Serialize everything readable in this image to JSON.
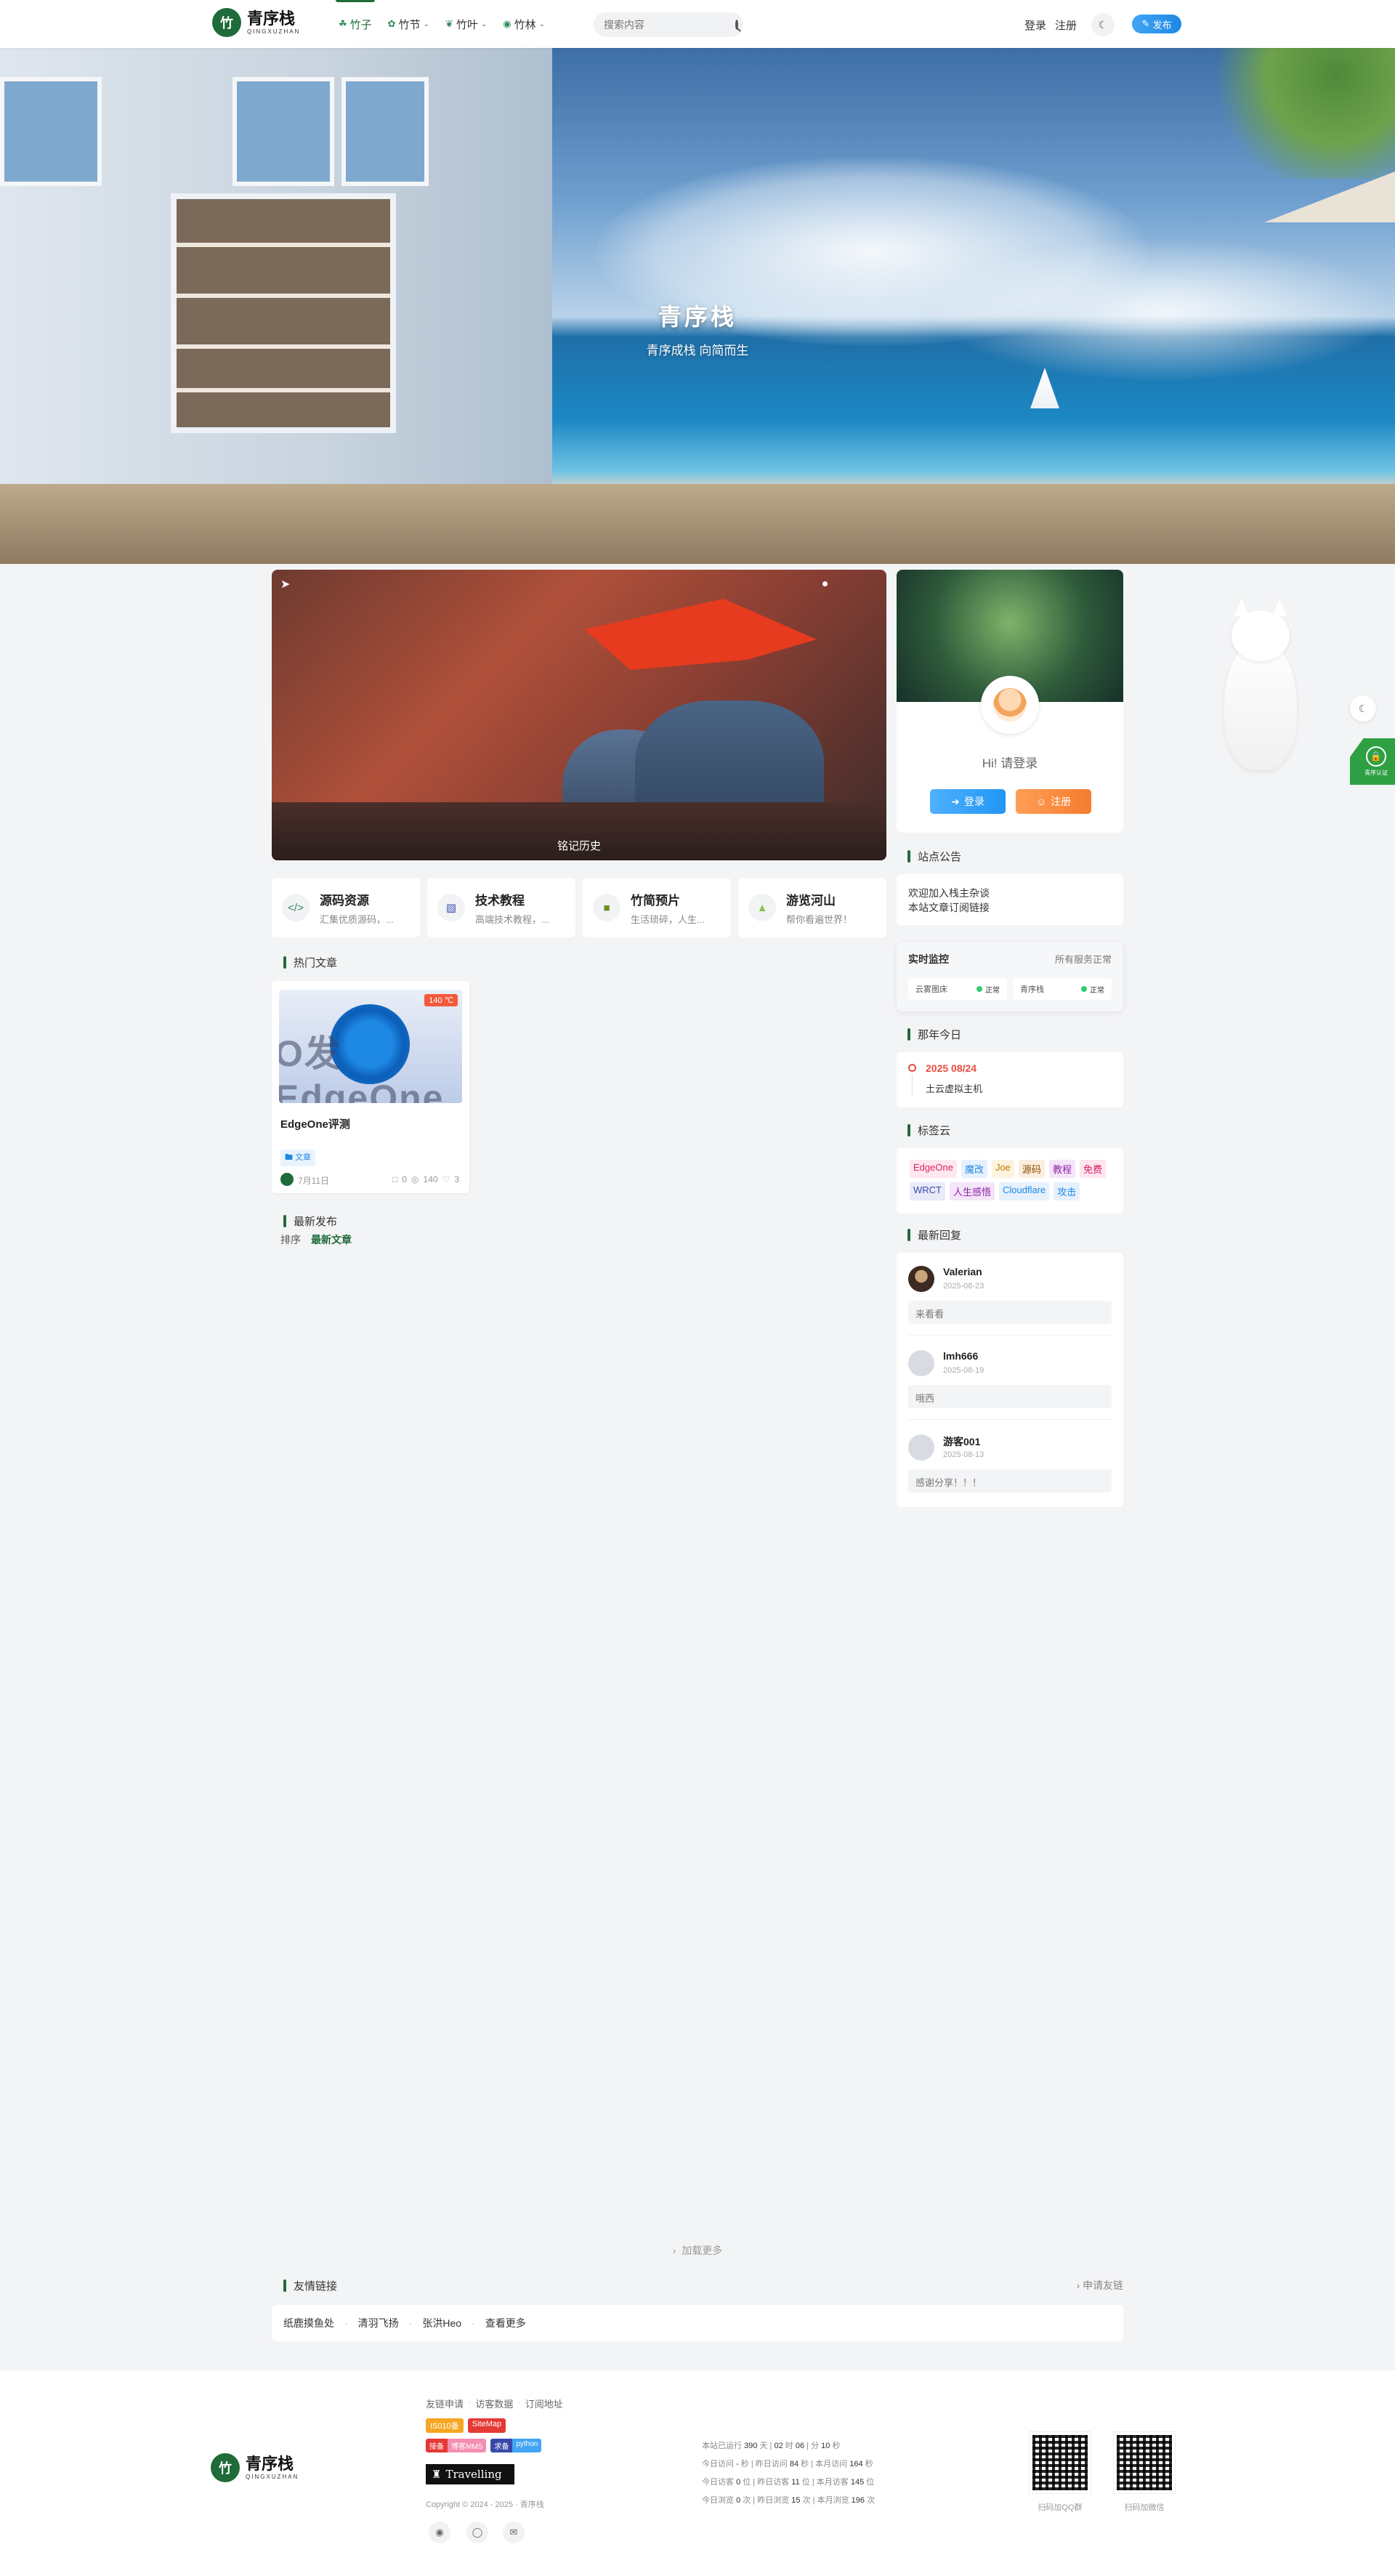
{
  "header": {
    "logo_title": "青序栈",
    "logo_sub": "QINGXUZHAN",
    "nav": [
      {
        "label": "竹子",
        "has_menu": false,
        "active": true
      },
      {
        "label": "竹节",
        "has_menu": true
      },
      {
        "label": "竹叶",
        "has_menu": true
      },
      {
        "label": "竹林",
        "has_menu": true
      }
    ],
    "search_placeholder": "搜索内容",
    "login": "登录",
    "register": "注册",
    "publish": "发布"
  },
  "hero": {
    "title": "青序栈",
    "subtitle": "青序成栈 向简而生"
  },
  "slider": {
    "caption": "铭记历史"
  },
  "categories": [
    {
      "title": "源码资源",
      "desc": "汇集优质源码，...",
      "icon": "code-icon"
    },
    {
      "title": "技术教程",
      "desc": "高端技术教程，...",
      "icon": "image-icon"
    },
    {
      "title": "竹简预片",
      "desc": "生活琐碎，人生...",
      "icon": "picture-icon"
    },
    {
      "title": "游览河山",
      "desc": "帮你看遍世界！",
      "icon": "mountain-icon"
    }
  ],
  "hot": {
    "title": "热门文章",
    "post": {
      "title": "EdgeOne评测",
      "temp": "140 ℃",
      "thumb_text": "O发EdgeOne评测",
      "tag": "文章",
      "date": "7月11日",
      "comments": "0",
      "views": "140",
      "likes": "3"
    }
  },
  "latest": {
    "title": "最新发布",
    "sort_label": "排序",
    "active_tab": "最新文章"
  },
  "load_more": "加载更多",
  "friends": {
    "title": "友情链接",
    "apply": "申请友链",
    "links": [
      "纸鹿摸鱼处",
      "清羽飞扬",
      "张洪Heo",
      "查看更多"
    ]
  },
  "profile": {
    "greeting": "Hi! 请登录",
    "login": "登录",
    "register": "注册"
  },
  "notice": {
    "title": "站点公告",
    "lines": [
      "欢迎加入栈主杂谈",
      "本站文章订阅链接"
    ]
  },
  "monitor": {
    "title": "实时监控",
    "status": "所有服务正常",
    "items": [
      {
        "name": "云雾图床",
        "state": "正常"
      },
      {
        "name": "青序栈",
        "state": "正常"
      }
    ]
  },
  "today": {
    "title": "那年今日",
    "date": "2025 08/24",
    "text": "土云虚拟主机"
  },
  "tags": {
    "title": "标签云",
    "items": [
      {
        "label": "EdgeOne",
        "color": "#e0245e",
        "bg": "#fde8ef"
      },
      {
        "label": "魔改",
        "color": "#1e88e5",
        "bg": "#e6f1fd"
      },
      {
        "label": "Joe",
        "color": "#c07a00",
        "bg": "#fdf3e0"
      },
      {
        "label": "源码",
        "color": "#8a4b00",
        "bg": "#fbeede"
      },
      {
        "label": "教程",
        "color": "#8e24aa",
        "bg": "#f4e5f9"
      },
      {
        "label": "免费",
        "color": "#d81b60",
        "bg": "#fde6ef"
      },
      {
        "label": "WRCT",
        "color": "#3949ab",
        "bg": "#e8eaf8"
      },
      {
        "label": "人生感悟",
        "color": "#8e24aa",
        "bg": "#f4e5f9"
      },
      {
        "label": "Cloudflare",
        "color": "#1e88e5",
        "bg": "#e6f1fd"
      },
      {
        "label": "攻击",
        "color": "#1e88e5",
        "bg": "#e6f1fd"
      }
    ]
  },
  "replies": {
    "title": "最新回复",
    "items": [
      {
        "name": "Valerian",
        "date": "2025-08-23",
        "text": "来看看"
      },
      {
        "name": "lmh666",
        "date": "2025-08-19",
        "text": "哦西"
      },
      {
        "name": "游客001",
        "date": "2025-08-13",
        "text": "感谢分享！！！"
      }
    ]
  },
  "footer": {
    "links": [
      "友链申请",
      "访客数据",
      "订阅地址"
    ],
    "badges1": [
      {
        "label": "IS010备",
        "bg": "#f6a623"
      },
      {
        "label": "SiteMap",
        "bg": "#e53935"
      }
    ],
    "badges2": [
      {
        "left": "接备",
        "right": "博客MMS",
        "lbg": "#e53935",
        "rbg": "#f48fb1"
      },
      {
        "left": "求备",
        "right": "python",
        "lbg": "#3949ab",
        "rbg": "#42a5f5"
      }
    ],
    "travel": "Travelling",
    "copyright": "Copyright © 2024 - 2025 · 青序栈",
    "stats": [
      [
        "本站已运行",
        "390",
        "天",
        "02",
        "时",
        "06",
        "分",
        "10",
        "秒"
      ],
      [
        "今日访问",
        "-",
        "秒",
        "昨日访问",
        "84",
        "秒",
        "本月访问",
        "164",
        "秒"
      ],
      [
        "今日访客",
        "0",
        "位",
        "昨日访客",
        "11",
        "位",
        "本月访客",
        "145",
        "位"
      ],
      [
        "今日浏览",
        "0",
        "次",
        "昨日浏览",
        "15",
        "次",
        "本月浏览",
        "196",
        "次"
      ]
    ],
    "qr": [
      {
        "caption": "扫码加QQ群"
      },
      {
        "caption": "扫码加微信"
      }
    ]
  },
  "side_badge": "青序认证"
}
